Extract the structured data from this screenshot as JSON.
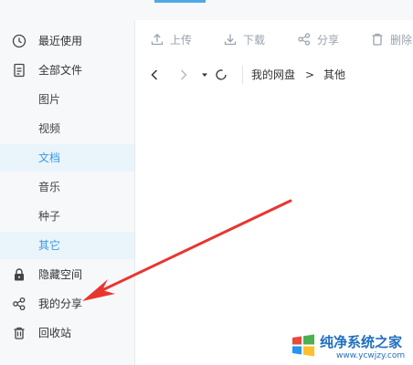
{
  "sidebar": {
    "items": [
      {
        "label": "最近使用",
        "icon": "clock-icon"
      },
      {
        "label": "全部文件",
        "icon": "document-icon"
      },
      {
        "label": "图片"
      },
      {
        "label": "视频"
      },
      {
        "label": "文档"
      },
      {
        "label": "音乐"
      },
      {
        "label": "种子"
      },
      {
        "label": "其它"
      },
      {
        "label": "隐藏空间",
        "icon": "lock-icon"
      },
      {
        "label": "我的分享",
        "icon": "share-icon"
      },
      {
        "label": "回收站",
        "icon": "trash-icon"
      }
    ],
    "active_items": [
      "文档",
      "其它"
    ]
  },
  "toolbar": {
    "upload_label": "上传",
    "download_label": "下载",
    "share_label": "分享",
    "delete_label": "删除"
  },
  "path": {
    "crumbs": [
      "我的网盘",
      "其他"
    ],
    "separator": ">"
  },
  "watermark": {
    "text": "纯净系统之家",
    "url": "www.ycwjzy.com"
  },
  "colors": {
    "accent": "#3c9be0",
    "active_bg": "#eaf4fb",
    "sidebar_bg": "#f7f8fa",
    "arrow": "#e8362f"
  }
}
